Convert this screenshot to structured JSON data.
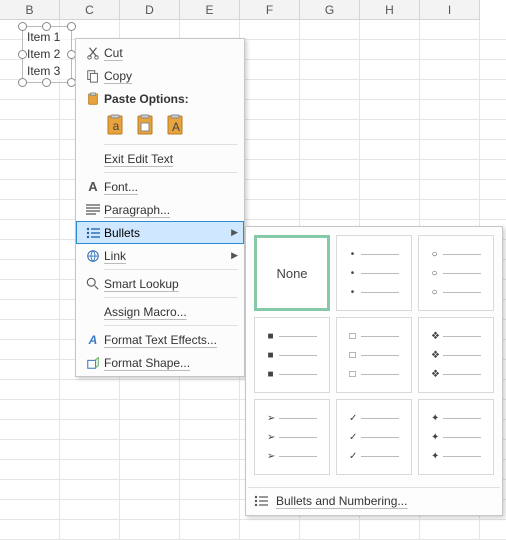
{
  "columns": [
    "B",
    "C",
    "D",
    "E",
    "F",
    "G",
    "H",
    "I"
  ],
  "textbox": {
    "items": [
      "Item 1",
      "Item 2",
      "Item 3"
    ]
  },
  "context_menu": {
    "cut": "Cut",
    "copy": "Copy",
    "paste_options": "Paste Options:",
    "exit_edit": "Exit Edit Text",
    "font": "Font...",
    "paragraph": "Paragraph...",
    "bullets": "Bullets",
    "link": "Link",
    "smart_lookup": "Smart Lookup",
    "assign_macro": "Assign Macro...",
    "format_text_effects": "Format Text Effects...",
    "format_shape": "Format Shape..."
  },
  "bullet_gallery": {
    "none": "None",
    "footer": "Bullets and Numbering...",
    "options": [
      {
        "name": "none"
      },
      {
        "name": "disc",
        "glyph": "•"
      },
      {
        "name": "circle",
        "glyph": "○"
      },
      {
        "name": "square",
        "glyph": "■"
      },
      {
        "name": "hollow-square",
        "glyph": "□"
      },
      {
        "name": "diamond",
        "glyph": "❖"
      },
      {
        "name": "arrow",
        "glyph": "➢"
      },
      {
        "name": "check",
        "glyph": "✓"
      },
      {
        "name": "star",
        "glyph": "✦"
      }
    ]
  }
}
